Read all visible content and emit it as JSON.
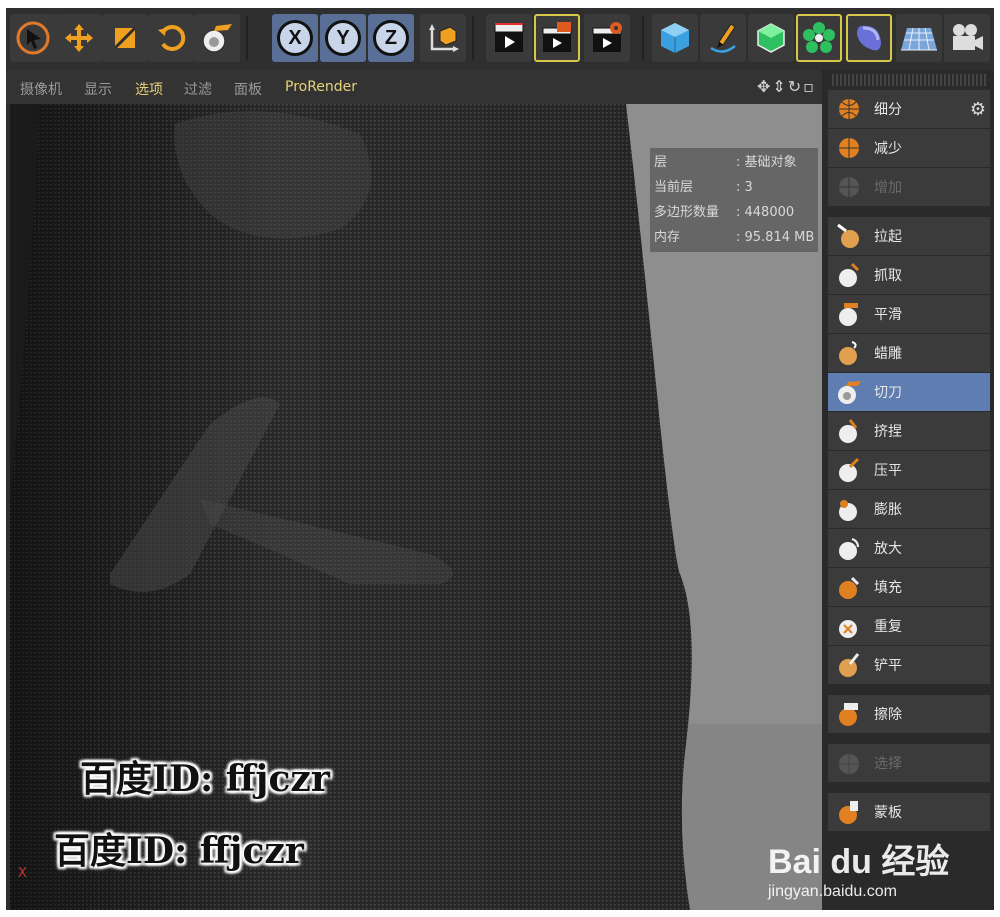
{
  "menu": {
    "items": [
      "摄像机",
      "显示",
      "选项",
      "过滤",
      "面板"
    ],
    "active_index": 2,
    "prorender": "ProRender"
  },
  "toolbar": {
    "axis_x": "X",
    "axis_y": "Y",
    "axis_z": "Z"
  },
  "info": {
    "rows": [
      {
        "key": "层",
        "value": ": 基础对象"
      },
      {
        "key": "当前层",
        "value": ": 3"
      },
      {
        "key": "多边形数量",
        "value": ": 448000"
      },
      {
        "key": "内存",
        "value": ": 95.814 MB"
      }
    ]
  },
  "viewport": {
    "axis_label": "X"
  },
  "watermark": {
    "line1": "百度ID: ffjczr",
    "line2": "百度ID: ffjczr",
    "logo": "Bai du 经验",
    "url": "jingyan.baidu.com"
  },
  "panel": {
    "group1": [
      {
        "label": "细分",
        "icon": "subdivide-icon"
      },
      {
        "label": "减少",
        "icon": "decrease-icon"
      },
      {
        "label": "增加",
        "icon": "increase-icon",
        "disabled": true
      }
    ],
    "group2": [
      {
        "label": "拉起",
        "icon": "pull-brush-icon"
      },
      {
        "label": "抓取",
        "icon": "grab-brush-icon"
      },
      {
        "label": "平滑",
        "icon": "smooth-brush-icon"
      },
      {
        "label": "蜡雕",
        "icon": "wax-brush-icon"
      },
      {
        "label": "切刀",
        "icon": "knife-brush-icon",
        "selected": true
      },
      {
        "label": "挤捏",
        "icon": "pinch-brush-icon"
      },
      {
        "label": "压平",
        "icon": "flatten-brush-icon"
      },
      {
        "label": "膨胀",
        "icon": "inflate-brush-icon"
      },
      {
        "label": "放大",
        "icon": "magnify-brush-icon"
      },
      {
        "label": "填充",
        "icon": "fill-brush-icon"
      },
      {
        "label": "重复",
        "icon": "repeat-brush-icon"
      },
      {
        "label": "铲平",
        "icon": "scrape-brush-icon"
      }
    ],
    "group3": [
      {
        "label": "擦除",
        "icon": "erase-brush-icon"
      }
    ],
    "group4": [
      {
        "label": "选择",
        "icon": "select-brush-icon",
        "disabled": true
      }
    ],
    "group5": [
      {
        "label": "蒙板",
        "icon": "mask-brush-icon"
      }
    ]
  }
}
